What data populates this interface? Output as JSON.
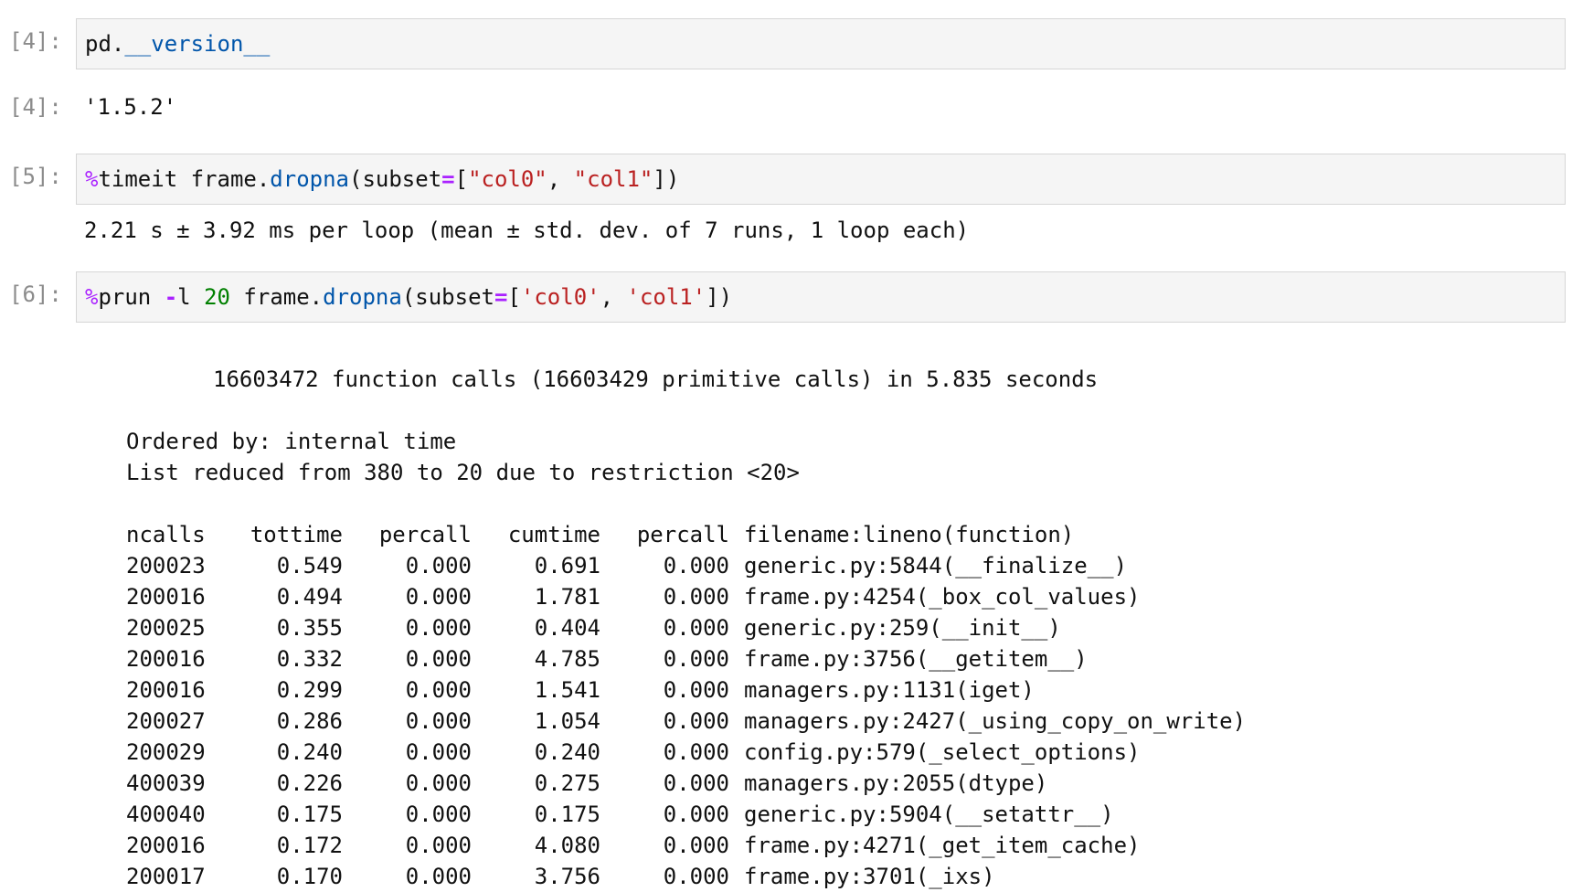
{
  "cells": [
    {
      "prompt_in": "[4]:",
      "code": {
        "obj": "pd.",
        "attr": "__version__"
      },
      "prompt_out": "[4]:",
      "output": "'1.5.2'"
    },
    {
      "prompt_in": "[5]:",
      "code": {
        "magic": "%",
        "cmd": "timeit frame.",
        "method": "dropna",
        "open": "(subset",
        "eq": "=",
        "bracket_open": "[",
        "s1": "\"col0\"",
        "sep": ", ",
        "s2": "\"col1\"",
        "close": "])"
      },
      "output": "2.21 s ± 3.92 ms per loop (mean ± std. dev. of 7 runs, 1 loop each)"
    },
    {
      "prompt_in": "[6]:",
      "code": {
        "magic": "%",
        "cmd": "prun ",
        "flag_op": "-",
        "flag": "l ",
        "num": "20",
        "rest": " frame.",
        "method": "dropna",
        "open": "(subset",
        "eq": "=",
        "bracket_open": "[",
        "s1": "'col0'",
        "sep": ", ",
        "s2": "'col1'",
        "close": "])"
      }
    }
  ],
  "profile": {
    "summary": "16603472 function calls (16603429 primitive calls) in 5.835 seconds",
    "ordered_by": "Ordered by: internal time",
    "list_reduced": "List reduced from 380 to 20 due to restriction <20>",
    "headers": [
      "ncalls",
      "tottime",
      "percall",
      "cumtime",
      "percall",
      "filename:lineno(function)"
    ],
    "rows": [
      [
        "200023",
        "0.549",
        "0.000",
        "0.691",
        "0.000",
        "generic.py:5844(__finalize__)"
      ],
      [
        "200016",
        "0.494",
        "0.000",
        "1.781",
        "0.000",
        "frame.py:4254(_box_col_values)"
      ],
      [
        "200025",
        "0.355",
        "0.000",
        "0.404",
        "0.000",
        "generic.py:259(__init__)"
      ],
      [
        "200016",
        "0.332",
        "0.000",
        "4.785",
        "0.000",
        "frame.py:3756(__getitem__)"
      ],
      [
        "200016",
        "0.299",
        "0.000",
        "1.541",
        "0.000",
        "managers.py:1131(iget)"
      ],
      [
        "200027",
        "0.286",
        "0.000",
        "1.054",
        "0.000",
        "managers.py:2427(_using_copy_on_write)"
      ],
      [
        "200029",
        "0.240",
        "0.000",
        "0.240",
        "0.000",
        "config.py:579(_select_options)"
      ],
      [
        "400039",
        "0.226",
        "0.000",
        "0.275",
        "0.000",
        "managers.py:2055(dtype)"
      ],
      [
        "400040",
        "0.175",
        "0.000",
        "0.175",
        "0.000",
        "generic.py:5904(__setattr__)"
      ],
      [
        "200016",
        "0.172",
        "0.000",
        "4.080",
        "0.000",
        "frame.py:4271(_get_item_cache)"
      ],
      [
        "200017",
        "0.170",
        "0.000",
        "3.756",
        "0.000",
        "frame.py:3701(_ixs)"
      ]
    ]
  }
}
